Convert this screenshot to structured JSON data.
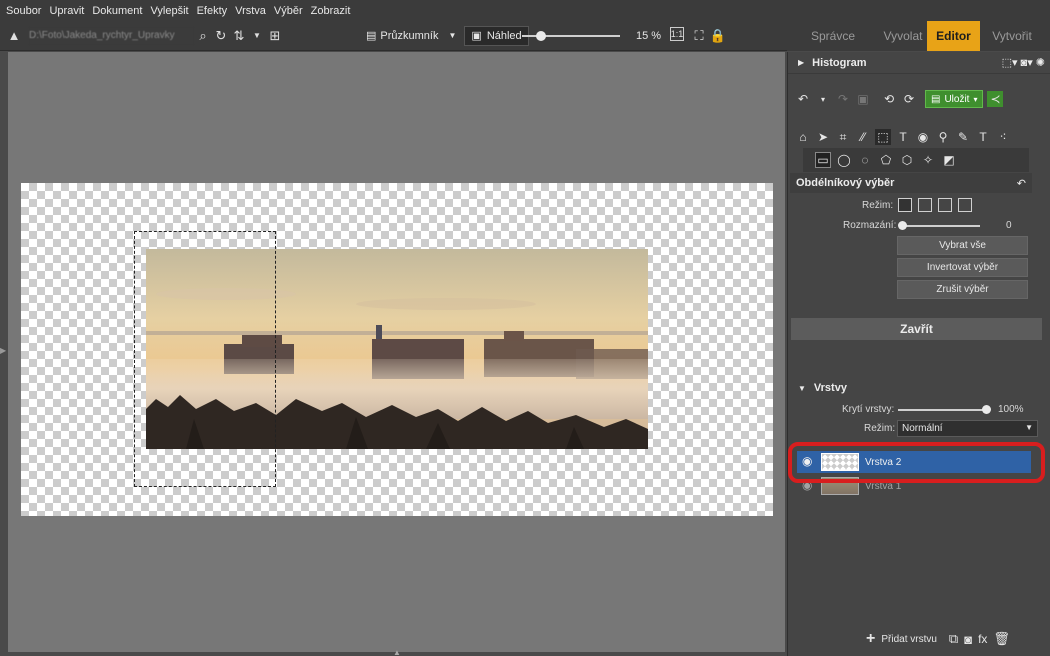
{
  "menu": [
    {
      "label": "Soubor"
    },
    {
      "label": "Upravit"
    },
    {
      "label": "Dokument"
    },
    {
      "label": "Vylepšit"
    },
    {
      "label": "Efekty"
    },
    {
      "label": "Vrstva"
    },
    {
      "label": "Výběr"
    },
    {
      "label": "Zobrazit"
    }
  ],
  "toolbar": {
    "path": "D:\\Foto\\Jakeda_rychtyr_Upravky",
    "browser_label": "Průzkumník",
    "preview_label": "Náhled",
    "zoom_value": "15 %",
    "zoom_fraction": 0.15
  },
  "modes": [
    {
      "label": "Správce",
      "active": false
    },
    {
      "label": "Vyvolat",
      "active": false
    },
    {
      "label": "Editor",
      "active": true
    },
    {
      "label": "Vytvořit",
      "active": false
    }
  ],
  "panel": {
    "histogram_title": "Histogram",
    "save_label": "Uložit",
    "tool_title": "Obdélníkový výběr",
    "mode_label": "Režim:",
    "blur_label": "Rozmazání:",
    "blur_value": "0",
    "select_all": "Vybrat vše",
    "invert_selection": "Invertovat výběr",
    "cancel_selection": "Zrušit výběr",
    "close": "Zavřít",
    "layers_title": "Vrstvy",
    "opacity_label": "Krytí vrstvy:",
    "opacity_value": "100%",
    "layer_mode_label": "Režim:",
    "layer_mode_value": "Normální",
    "layers": [
      {
        "name": "Vrstva 2",
        "selected": true
      },
      {
        "name": "Vrstva 1",
        "selected": false
      }
    ],
    "add_layer": "Přidat vrstvu",
    "fx": "fx"
  },
  "colors": {
    "accent": "#e8a317",
    "selection": "#2f62a6",
    "save_green": "#3f8f2e",
    "highlight": "#d81e1e"
  }
}
